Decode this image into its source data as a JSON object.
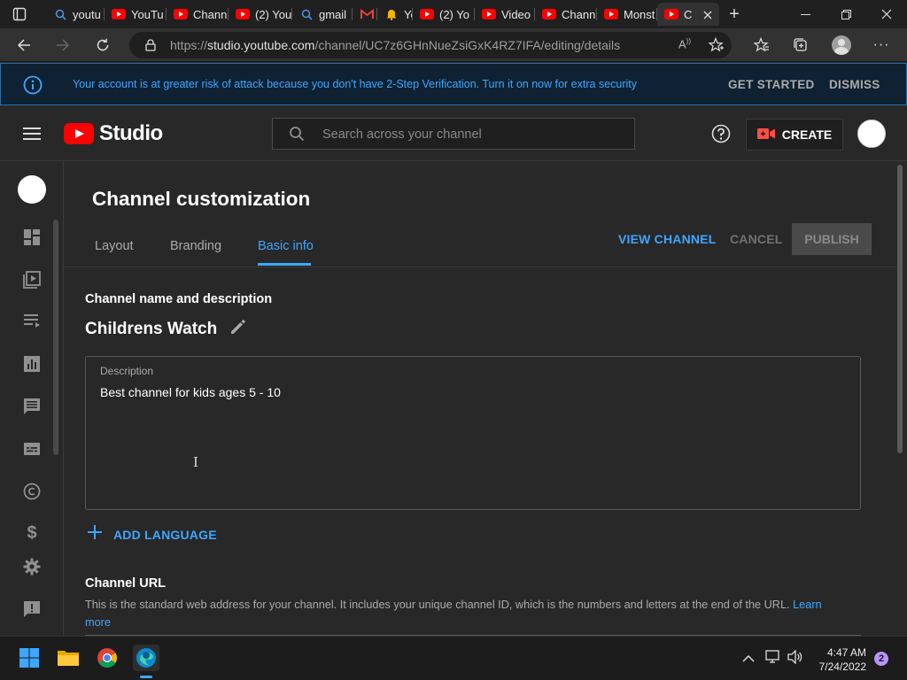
{
  "browser": {
    "tabs": [
      {
        "label": "youtu",
        "favicon": "search-icon"
      },
      {
        "label": "YouTu",
        "favicon": "youtube-icon"
      },
      {
        "label": "Chann",
        "favicon": "youtube-icon"
      },
      {
        "label": "(2) You",
        "favicon": "youtube-icon"
      },
      {
        "label": "gmail",
        "favicon": "search-icon"
      },
      {
        "label": "",
        "favicon": "gmail-icon"
      },
      {
        "label": "Yo",
        "favicon": "bell-icon"
      },
      {
        "label": "(2) Yo",
        "favicon": "youtube-icon"
      },
      {
        "label": "Video",
        "favicon": "youtube-icon"
      },
      {
        "label": "Chann",
        "favicon": "youtube-icon"
      },
      {
        "label": "Monst",
        "favicon": "youtube-icon"
      },
      {
        "label": "C",
        "favicon": "youtube-icon",
        "active": true
      }
    ],
    "url_prefix": "https://",
    "url_host": "studio.youtube.com",
    "url_path": "/channel/UC7z6GHnNueZsiGxK4RZ7IFA/editing/details"
  },
  "banner": {
    "message": "Your account is at greater risk of attack because you don't have 2-Step Verification. Turn it on now for extra security",
    "get_started": "GET STARTED",
    "dismiss": "DISMISS"
  },
  "header": {
    "logo_text": "Studio",
    "search_placeholder": "Search across your channel",
    "create_label": "CREATE"
  },
  "page": {
    "title": "Channel customization",
    "tabs": [
      "Layout",
      "Branding",
      "Basic info"
    ],
    "active_tab": "Basic info",
    "view_channel": "VIEW CHANNEL",
    "cancel": "CANCEL",
    "publish": "PUBLISH"
  },
  "basic_info": {
    "section_title": "Channel name and description",
    "channel_name": "Childrens Watch",
    "description_label": "Description",
    "description_value": "Best channel for kids ages 5 - 10",
    "add_language": "ADD LANGUAGE",
    "url_section_title": "Channel URL",
    "url_help_text": "This is the standard web address for your channel. It includes your unique channel ID, which is the numbers and letters at the end of the URL.",
    "learn_more": "Learn more"
  },
  "taskbar": {
    "time": "4:47 AM",
    "date": "7/24/2022",
    "notification_count": "2"
  },
  "colors": {
    "accent_blue": "#3ea6ff",
    "youtube_red": "#ff0000",
    "background": "#282828"
  }
}
